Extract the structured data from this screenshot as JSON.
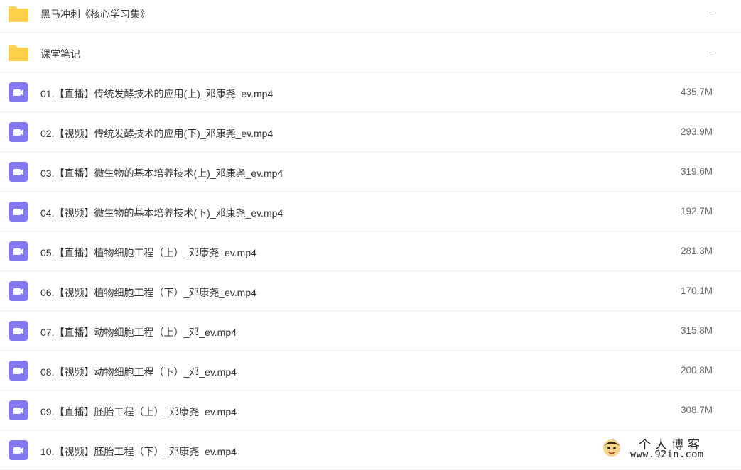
{
  "files": [
    {
      "name": "黑马冲刺《核心学习集》",
      "size": "-",
      "type": "folder"
    },
    {
      "name": "课堂笔记",
      "size": "-",
      "type": "folder"
    },
    {
      "name": "01.【直播】传统发酵技术的应用(上)_邓康尧_ev.mp4",
      "size": "435.7M",
      "type": "video"
    },
    {
      "name": "02.【视频】传统发酵技术的应用(下)_邓康尧_ev.mp4",
      "size": "293.9M",
      "type": "video"
    },
    {
      "name": "03.【直播】微生物的基本培养技术(上)_邓康尧_ev.mp4",
      "size": "319.6M",
      "type": "video"
    },
    {
      "name": "04.【视频】微生物的基本培养技术(下)_邓康尧_ev.mp4",
      "size": "192.7M",
      "type": "video"
    },
    {
      "name": "05.【直播】植物细胞工程（上）_邓康尧_ev.mp4",
      "size": "281.3M",
      "type": "video"
    },
    {
      "name": "06.【视频】植物细胞工程（下）_邓康尧_ev.mp4",
      "size": "170.1M",
      "type": "video"
    },
    {
      "name": "07.【直播】动物细胞工程（上）_邓_ev.mp4",
      "size": "315.8M",
      "type": "video"
    },
    {
      "name": "08.【视频】动物细胞工程（下）_邓_ev.mp4",
      "size": "200.8M",
      "type": "video"
    },
    {
      "name": "09.【直播】胚胎工程（上）_邓康尧_ev.mp4",
      "size": "308.7M",
      "type": "video"
    },
    {
      "name": "10.【视频】胚胎工程（下）_邓康尧_ev.mp4",
      "size": "",
      "type": "video"
    }
  ],
  "watermark": {
    "title": "个人博客",
    "url": "www.92in.com"
  },
  "colors": {
    "folder": "#ffd45a",
    "video": "#8378f0",
    "divider": "#eef0f4"
  }
}
